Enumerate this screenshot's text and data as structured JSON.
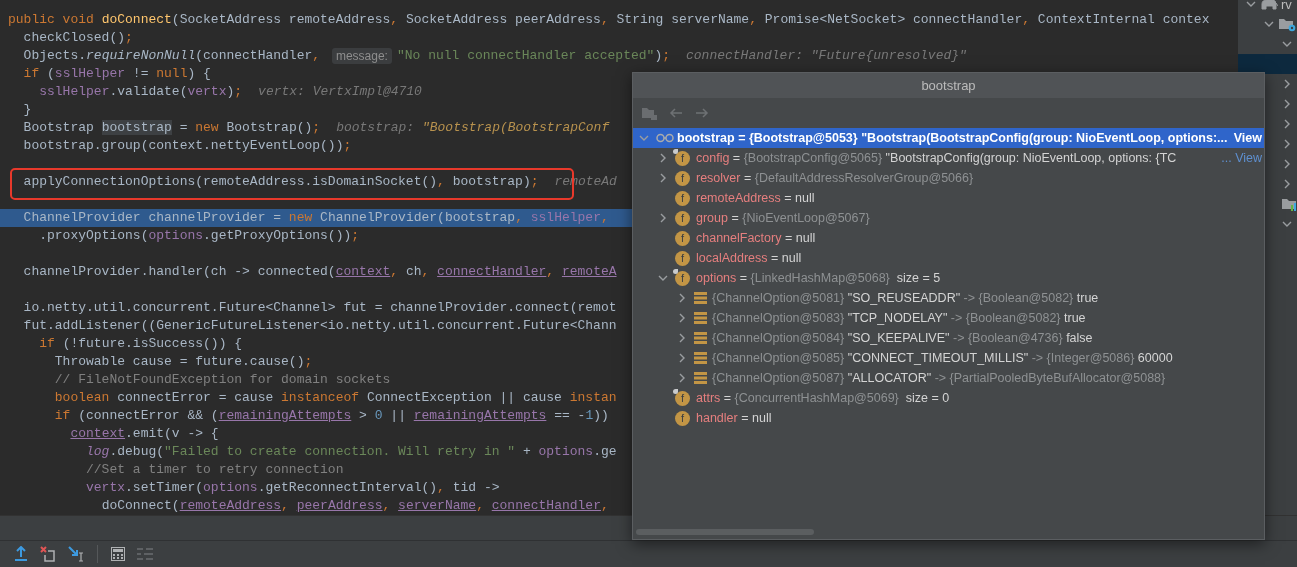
{
  "editor": {
    "lines": [
      {
        "kind": "code",
        "selected": false,
        "boxed": false,
        "parts": [
          {
            "kind": "code",
            "tokens": [
              {
                "text": "public void ",
                "kind": "k"
              },
              {
                "text": "doConnect",
                "kind": "fn"
              },
              {
                "text": "(SocketAddress remoteAddress",
                "kind": "p"
              },
              {
                "text": ", ",
                "kind": "k"
              },
              {
                "text": "SocketAddress peerAddress",
                "kind": "p"
              },
              {
                "text": ", ",
                "kind": "k"
              },
              {
                "text": "String serverName",
                "kind": "p"
              },
              {
                "text": ", ",
                "kind": "k"
              },
              {
                "text": "Promise<NetSocket> connectHandler",
                "kind": "p"
              },
              {
                "text": ", ",
                "kind": "k"
              },
              {
                "text": "ContextInternal contex",
                "kind": "p"
              }
            ]
          }
        ]
      },
      {
        "kind": "code",
        "selected": false,
        "boxed": false,
        "parts": [
          {
            "kind": "code",
            "tokens": [
              {
                "text": "  checkClosed()",
                "kind": "p"
              },
              {
                "text": ";",
                "kind": "k"
              }
            ]
          }
        ]
      },
      {
        "kind": "code",
        "selected": false,
        "boxed": false,
        "parts": [
          {
            "kind": "code",
            "tokens": [
              {
                "text": "  Objects.",
                "kind": "p"
              },
              {
                "text": "requireNonNull",
                "kind": "i"
              },
              {
                "text": "(connectHandler",
                "kind": "p"
              },
              {
                "text": ", ",
                "kind": "k"
              }
            ]
          },
          {
            "kind": "param_hint",
            "text": "message:"
          },
          {
            "kind": "code",
            "tokens": [
              {
                "text": "\"No null connectHandler accepted\"",
                "kind": "s"
              },
              {
                "text": ")",
                "kind": "p"
              },
              {
                "text": ";",
                "kind": "k"
              }
            ]
          },
          {
            "kind": "value_hint",
            "tokens": [
              {
                "text": "connectHandler: \"Future{unresolved}\"",
                "kind": "h"
              }
            ]
          }
        ]
      },
      {
        "kind": "code",
        "selected": false,
        "boxed": false,
        "parts": [
          {
            "kind": "code",
            "tokens": [
              {
                "text": "  if ",
                "kind": "k"
              },
              {
                "text": "(",
                "kind": "p"
              },
              {
                "text": "sslHelper",
                "kind": "f"
              },
              {
                "text": " != ",
                "kind": "p"
              },
              {
                "text": "null",
                "kind": "k"
              },
              {
                "text": ") {",
                "kind": "p"
              }
            ]
          }
        ]
      },
      {
        "kind": "code",
        "selected": false,
        "boxed": false,
        "parts": [
          {
            "kind": "code",
            "tokens": [
              {
                "text": "    sslHelper",
                "kind": "f"
              },
              {
                "text": ".validate(",
                "kind": "p"
              },
              {
                "text": "vertx",
                "kind": "f"
              },
              {
                "text": ")",
                "kind": "p"
              },
              {
                "text": ";",
                "kind": "k"
              }
            ]
          },
          {
            "kind": "value_hint",
            "tokens": [
              {
                "text": "vertx: VertxImpl@4710",
                "kind": "h"
              }
            ]
          }
        ]
      },
      {
        "kind": "code",
        "selected": false,
        "boxed": false,
        "parts": [
          {
            "kind": "code",
            "tokens": [
              {
                "text": "  }",
                "kind": "p"
              }
            ]
          }
        ]
      },
      {
        "kind": "code",
        "selected": false,
        "boxed": false,
        "parts": [
          {
            "kind": "code",
            "tokens": [
              {
                "text": "  Bootstrap ",
                "kind": "p"
              },
              {
                "text": "bootstrap",
                "kind": "hl"
              },
              {
                "text": " = ",
                "kind": "p"
              },
              {
                "text": "new ",
                "kind": "k"
              },
              {
                "text": "Bootstrap()",
                "kind": "p"
              },
              {
                "text": ";",
                "kind": "k"
              }
            ]
          },
          {
            "kind": "value_hint",
            "tokens": [
              {
                "text": "bootstrap: ",
                "kind": "h"
              },
              {
                "text": "\"Bootstrap(BootstrapConf",
                "kind": "hs"
              }
            ]
          }
        ]
      },
      {
        "kind": "code",
        "selected": false,
        "boxed": false,
        "parts": [
          {
            "kind": "code",
            "tokens": [
              {
                "text": "  bootstrap.group(context.nettyEventLoop())",
                "kind": "p"
              },
              {
                "text": ";",
                "kind": "k"
              }
            ]
          }
        ]
      },
      {
        "kind": "blank"
      },
      {
        "kind": "code",
        "selected": false,
        "boxed": true,
        "parts": [
          {
            "kind": "code",
            "tokens": [
              {
                "text": "  applyConnectionOptions(remoteAddress.isDomainSocket()",
                "kind": "p"
              },
              {
                "text": ", ",
                "kind": "k"
              },
              {
                "text": "bootstrap)",
                "kind": "p"
              },
              {
                "text": ";",
                "kind": "k"
              }
            ]
          },
          {
            "kind": "value_hint",
            "tokens": [
              {
                "text": "remoteAd",
                "kind": "h"
              }
            ]
          }
        ]
      },
      {
        "kind": "blank"
      },
      {
        "kind": "code",
        "selected": true,
        "boxed": false,
        "parts": [
          {
            "kind": "code",
            "tokens": [
              {
                "text": "  ChannelProvider channelProvider = ",
                "kind": "p"
              },
              {
                "text": "new ",
                "kind": "k"
              },
              {
                "text": "ChannelProvider(bootstrap",
                "kind": "p"
              },
              {
                "text": ", ",
                "kind": "k"
              },
              {
                "text": "sslHelper",
                "kind": "f"
              },
              {
                "text": ",",
                "kind": "k"
              }
            ]
          }
        ]
      },
      {
        "kind": "code",
        "selected": false,
        "boxed": false,
        "parts": [
          {
            "kind": "code",
            "tokens": [
              {
                "text": "    .proxyOptions(",
                "kind": "p"
              },
              {
                "text": "options",
                "kind": "f"
              },
              {
                "text": ".getProxyOptions())",
                "kind": "p"
              },
              {
                "text": ";",
                "kind": "k"
              }
            ]
          }
        ]
      },
      {
        "kind": "blank"
      },
      {
        "kind": "code",
        "selected": false,
        "boxed": false,
        "parts": [
          {
            "kind": "code",
            "tokens": [
              {
                "text": "  channelProvider.handler(ch -> connected(",
                "kind": "p"
              },
              {
                "text": "context",
                "kind": "fu"
              },
              {
                "text": ", ",
                "kind": "k"
              },
              {
                "text": "ch",
                "kind": "p"
              },
              {
                "text": ", ",
                "kind": "k"
              },
              {
                "text": "connectHandler",
                "kind": "fu"
              },
              {
                "text": ", ",
                "kind": "k"
              },
              {
                "text": "remoteA",
                "kind": "fu"
              }
            ]
          }
        ]
      },
      {
        "kind": "blank"
      },
      {
        "kind": "code",
        "selected": false,
        "boxed": false,
        "parts": [
          {
            "kind": "code",
            "tokens": [
              {
                "text": "  io.netty.util.concurrent.Future<Channel> fut = channelProvider.connect(remot",
                "kind": "p"
              }
            ]
          }
        ]
      },
      {
        "kind": "code",
        "selected": false,
        "boxed": false,
        "parts": [
          {
            "kind": "code",
            "tokens": [
              {
                "text": "  fut.addListener((GenericFutureListener<io.netty.util.concurrent.Future<Chann",
                "kind": "p"
              }
            ]
          }
        ]
      },
      {
        "kind": "code",
        "selected": false,
        "boxed": false,
        "parts": [
          {
            "kind": "code",
            "tokens": [
              {
                "text": "    if ",
                "kind": "k"
              },
              {
                "text": "(!future.isSuccess()) {",
                "kind": "p"
              }
            ]
          }
        ]
      },
      {
        "kind": "code",
        "selected": false,
        "boxed": false,
        "parts": [
          {
            "kind": "code",
            "tokens": [
              {
                "text": "      Throwable cause = future.cause()",
                "kind": "p"
              },
              {
                "text": ";",
                "kind": "k"
              }
            ]
          }
        ]
      },
      {
        "kind": "code",
        "selected": false,
        "boxed": false,
        "parts": [
          {
            "kind": "code",
            "tokens": [
              {
                "text": "      // FileNotFoundException for domain sockets",
                "kind": "c"
              }
            ]
          }
        ]
      },
      {
        "kind": "code",
        "selected": false,
        "boxed": false,
        "parts": [
          {
            "kind": "code",
            "tokens": [
              {
                "text": "      boolean ",
                "kind": "k"
              },
              {
                "text": "connectError = cause ",
                "kind": "p"
              },
              {
                "text": "instanceof ",
                "kind": "k"
              },
              {
                "text": "ConnectException || cause ",
                "kind": "p"
              },
              {
                "text": "instan",
                "kind": "k"
              }
            ]
          }
        ]
      },
      {
        "kind": "code",
        "selected": false,
        "boxed": false,
        "parts": [
          {
            "kind": "code",
            "tokens": [
              {
                "text": "      if ",
                "kind": "k"
              },
              {
                "text": "(connectError && (",
                "kind": "p"
              },
              {
                "text": "remainingAttempts",
                "kind": "fu"
              },
              {
                "text": " > ",
                "kind": "p"
              },
              {
                "text": "0",
                "kind": "n"
              },
              {
                "text": " || ",
                "kind": "p"
              },
              {
                "text": "remainingAttempts",
                "kind": "fu"
              },
              {
                "text": " == -",
                "kind": "p"
              },
              {
                "text": "1",
                "kind": "n"
              },
              {
                "text": "))",
                "kind": "p"
              }
            ]
          }
        ]
      },
      {
        "kind": "code",
        "selected": false,
        "boxed": false,
        "parts": [
          {
            "kind": "code",
            "tokens": [
              {
                "text": "        context",
                "kind": "fu"
              },
              {
                "text": ".emit(v -> {",
                "kind": "p"
              }
            ]
          }
        ]
      },
      {
        "kind": "code",
        "selected": false,
        "boxed": false,
        "parts": [
          {
            "kind": "code",
            "tokens": [
              {
                "text": "          log",
                "kind": "fi"
              },
              {
                "text": ".debug(",
                "kind": "p"
              },
              {
                "text": "\"Failed to create connection. Will retry in \"",
                "kind": "s"
              },
              {
                "text": " + ",
                "kind": "p"
              },
              {
                "text": "options",
                "kind": "f"
              },
              {
                "text": ".ge",
                "kind": "p"
              }
            ]
          }
        ]
      },
      {
        "kind": "code",
        "selected": false,
        "boxed": false,
        "parts": [
          {
            "kind": "code",
            "tokens": [
              {
                "text": "          //Set a timer to retry connection",
                "kind": "c"
              }
            ]
          }
        ]
      },
      {
        "kind": "code",
        "selected": false,
        "boxed": false,
        "parts": [
          {
            "kind": "code",
            "tokens": [
              {
                "text": "          vertx",
                "kind": "f"
              },
              {
                "text": ".setTimer(",
                "kind": "p"
              },
              {
                "text": "options",
                "kind": "f"
              },
              {
                "text": ".getReconnectInterval()",
                "kind": "p"
              },
              {
                "text": ", ",
                "kind": "k"
              },
              {
                "text": "tid ->",
                "kind": "p"
              }
            ]
          }
        ]
      },
      {
        "kind": "code",
        "selected": false,
        "boxed": false,
        "parts": [
          {
            "kind": "code",
            "tokens": [
              {
                "text": "            doConnect(",
                "kind": "p"
              },
              {
                "text": "remoteAddress",
                "kind": "fu"
              },
              {
                "text": ", ",
                "kind": "k"
              },
              {
                "text": "peerAddress",
                "kind": "fu"
              },
              {
                "text": ", ",
                "kind": "k"
              },
              {
                "text": "serverName",
                "kind": "fu"
              },
              {
                "text": ", ",
                "kind": "k"
              },
              {
                "text": "connectHandler",
                "kind": "fu"
              },
              {
                "text": ",",
                "kind": "k"
              }
            ]
          }
        ]
      }
    ]
  },
  "project_tree": [
    {
      "kind": "module",
      "label": "rv",
      "expanded": true,
      "selected": false,
      "children": [
        {
          "kind": "config_folder",
          "expanded": true,
          "selected": false,
          "children": [
            {
              "kind": "plain",
              "expanded": true,
              "selected": false
            },
            {
              "kind": "plain",
              "selected": true
            },
            {
              "kind": "plain",
              "expanded": false,
              "selected": false
            },
            {
              "kind": "plain",
              "expanded": false,
              "selected": false
            },
            {
              "kind": "plain",
              "expanded": false,
              "selected": false
            },
            {
              "kind": "plain",
              "expanded": false,
              "selected": false
            },
            {
              "kind": "plain",
              "expanded": false,
              "selected": false
            },
            {
              "kind": "plain",
              "expanded": false,
              "selected": false
            },
            {
              "kind": "chart_folder",
              "selected": false
            },
            {
              "kind": "plain",
              "expanded": true,
              "selected": false
            }
          ]
        }
      ]
    }
  ],
  "popup": {
    "title": "bootstrap",
    "tree": [
      {
        "kind": "watch",
        "name": "bootstrap",
        "sep": "=",
        "type": "{Bootstrap@5053}",
        "value": "\"Bootstrap(BootstrapConfig(group: NioEventLoop, options:...",
        "link": "View",
        "expanded": true,
        "selected": true,
        "children": [
          {
            "kind": "field",
            "badge": "f",
            "marked": true,
            "name": "config",
            "sep": "=",
            "type": "{BootstrapConfig@5065}",
            "value": "\"BootstrapConfig(group: NioEventLoop, options: {TC",
            "link": "... View",
            "expanded": false,
            "selected": false
          },
          {
            "kind": "field",
            "badge": "f",
            "marked": false,
            "name": "resolver",
            "sep": "=",
            "type": "{DefaultAddressResolverGroup@5066}",
            "expanded": false,
            "selected": false
          },
          {
            "kind": "field",
            "badge": "f",
            "marked": false,
            "name": "remoteAddress",
            "sep": "=",
            "value": "null",
            "selected": false
          },
          {
            "kind": "field",
            "badge": "f",
            "marked": false,
            "name": "group",
            "sep": "=",
            "type": "{NioEventLoop@5067}",
            "expanded": false,
            "selected": false
          },
          {
            "kind": "field",
            "badge": "f",
            "marked": false,
            "name": "channelFactory",
            "sep": "=",
            "value": "null",
            "selected": false
          },
          {
            "kind": "field",
            "badge": "f",
            "marked": false,
            "name": "localAddress",
            "sep": "=",
            "value": "null",
            "selected": false
          },
          {
            "kind": "field",
            "badge": "f",
            "marked": true,
            "name": "options",
            "sep": "=",
            "type": "{LinkedHashMap@5068}",
            "size": "size = 5",
            "expanded": true,
            "selected": false,
            "children": [
              {
                "kind": "entry",
                "type": "{ChannelOption@5081}",
                "key": "\"SO_REUSEADDR\"",
                "sep": "->",
                "value_type": "{Boolean@5082}",
                "value": "true",
                "expanded": false,
                "selected": false
              },
              {
                "kind": "entry",
                "type": "{ChannelOption@5083}",
                "key": "\"TCP_NODELAY\"",
                "sep": "->",
                "value_type": "{Boolean@5082}",
                "value": "true",
                "expanded": false,
                "selected": false
              },
              {
                "kind": "entry",
                "type": "{ChannelOption@5084}",
                "key": "\"SO_KEEPALIVE\"",
                "sep": "->",
                "value_type": "{Boolean@4736}",
                "value": "false",
                "expanded": false,
                "selected": false
              },
              {
                "kind": "entry",
                "type": "{ChannelOption@5085}",
                "key": "\"CONNECT_TIMEOUT_MILLIS\"",
                "sep": "->",
                "value_type": "{Integer@5086}",
                "value": "60000",
                "expanded": false,
                "selected": false
              },
              {
                "kind": "entry",
                "type": "{ChannelOption@5087}",
                "key": "\"ALLOCATOR\"",
                "sep": "->",
                "value_type": "{PartialPooledByteBufAllocator@5088}",
                "expanded": false,
                "selected": false
              }
            ]
          },
          {
            "kind": "field",
            "badge": "f",
            "marked": true,
            "name": "attrs",
            "sep": "=",
            "type": "{ConcurrentHashMap@5069}",
            "size": "size = 0",
            "selected": false
          },
          {
            "kind": "field",
            "badge": "f",
            "marked": false,
            "name": "handler",
            "sep": "=",
            "value": "null",
            "selected": false
          }
        ]
      }
    ]
  }
}
